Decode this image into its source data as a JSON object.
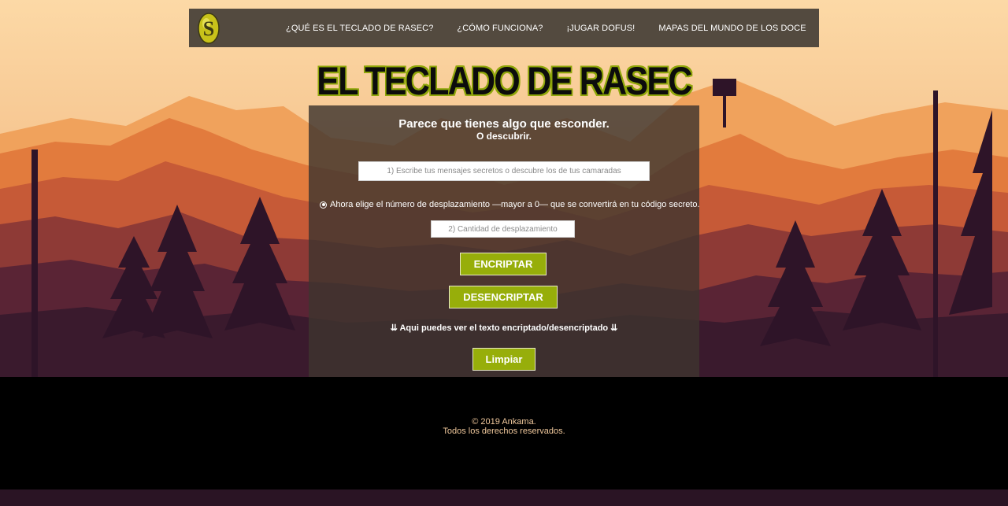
{
  "navbar": {
    "logo_icon": "dofus-s-emblem-icon",
    "links": [
      {
        "label": "¿QUÉ ES EL TECLADO DE RASEC?"
      },
      {
        "label": "¿CÓMO FUNCIONA?"
      },
      {
        "label": "¡JUGAR DOFUS!"
      },
      {
        "label": "MAPAS DEL MUNDO DE LOS DOCE"
      }
    ]
  },
  "title": "EL TECLADO DE RASEC",
  "panel": {
    "headline": "Parece que tienes algo que esconder.",
    "subheadline": "O descubrir.",
    "message_placeholder": "1) Escribe tus mensajes secretos o descubre los de tus camaradas",
    "radio_label": "Ahora elige el número de desplazamiento —mayor a 0— que se convertirá en tu código secreto.",
    "shift_placeholder": "2) Cantidad de desplazamiento",
    "encrypt_label": "ENCRIPTAR",
    "decrypt_label": "DESENCRIPTAR",
    "result_hint": "⇊ Aqui puedes ver el texto encriptado/desencriptado ⇊",
    "clear_label": "Limpiar"
  },
  "footer": {
    "copyright": "© 2019 Ankama.",
    "rights": "Todos los derechos reservados."
  },
  "colors": {
    "accent": "#97ae0a",
    "navbar_bg": "#534a3f",
    "footer_bg": "#000000",
    "footer_text": "#f0c89c"
  }
}
